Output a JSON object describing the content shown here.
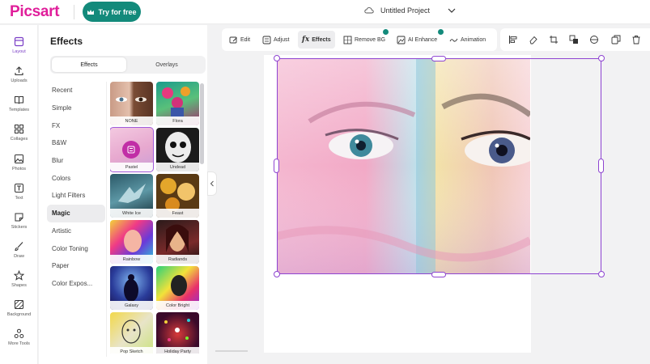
{
  "header": {
    "logo": "Picsart",
    "try_label": "Try for free",
    "project_title": "Untitled Project"
  },
  "rail": [
    {
      "label": "Layout",
      "icon": "layout-icon",
      "active": true
    },
    {
      "label": "Uploads",
      "icon": "upload-icon"
    },
    {
      "label": "Templates",
      "icon": "templates-icon"
    },
    {
      "label": "Collages",
      "icon": "collages-icon"
    },
    {
      "label": "Photos",
      "icon": "photos-icon"
    },
    {
      "label": "Text",
      "icon": "text-icon"
    },
    {
      "label": "Stickers",
      "icon": "stickers-icon"
    },
    {
      "label": "Draw",
      "icon": "draw-icon"
    },
    {
      "label": "Shapes",
      "icon": "shapes-icon"
    },
    {
      "label": "Background",
      "icon": "background-icon"
    },
    {
      "label": "More Tools",
      "icon": "more-tools-icon"
    }
  ],
  "panel": {
    "title": "Effects",
    "tabs": [
      "Effects",
      "Overlays"
    ],
    "categories": [
      "Recent",
      "Simple",
      "FX",
      "B&W",
      "Blur",
      "Colors",
      "Light Filters",
      "Magic",
      "Artistic",
      "Color Toning",
      "Paper",
      "Color Expos..."
    ],
    "active_category": "Magic",
    "thumbnails": [
      {
        "label": "NONE",
        "icon": "face-photo"
      },
      {
        "label": "Flora",
        "icon": "flowers"
      },
      {
        "label": "Pastel",
        "icon": "pastel-plant",
        "selected": true
      },
      {
        "label": "Undead",
        "icon": "skull-face"
      },
      {
        "label": "White Ice",
        "icon": "ice-bird"
      },
      {
        "label": "Feast",
        "icon": "food-plates"
      },
      {
        "label": "Rainbow",
        "icon": "rainbow-portrait"
      },
      {
        "label": "Radiands",
        "icon": "dark-portrait"
      },
      {
        "label": "Galaxy",
        "icon": "galaxy-figure"
      },
      {
        "label": "Color Bright",
        "icon": "bright-figure"
      },
      {
        "label": "Pop Sketch",
        "icon": "sketch-portrait"
      },
      {
        "label": "Holiday Party",
        "icon": "party-lights"
      }
    ]
  },
  "toolbar": {
    "edit": "Edit",
    "adjust": "Adjust",
    "effects": "Effects",
    "remove_bg": "Remove BG",
    "ai_enhance": "AI Enhance",
    "animation": "Animation"
  },
  "colors": {
    "brand": "#e01e9a",
    "try_button": "#138a7b",
    "selection": "#8e44d1"
  }
}
